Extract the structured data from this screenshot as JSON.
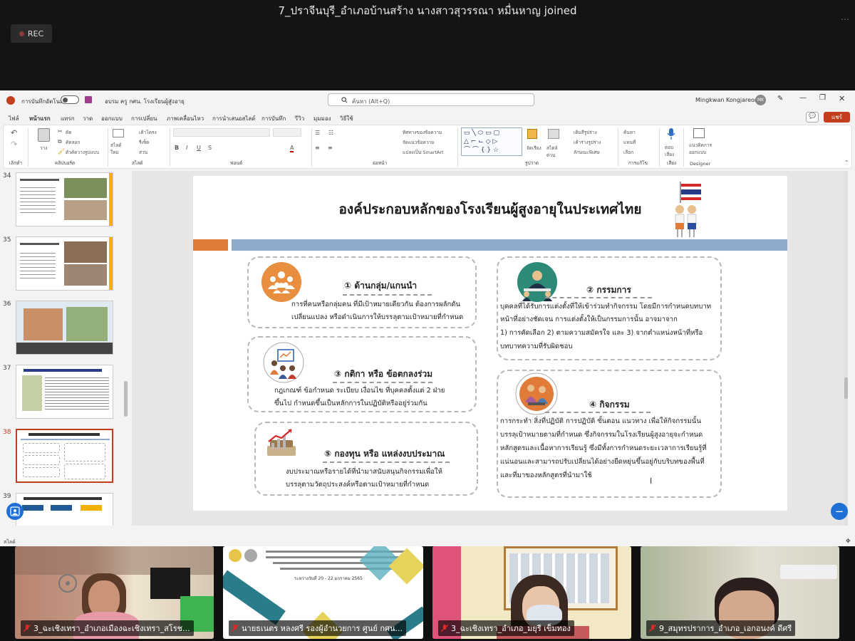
{
  "zoom": {
    "title": "7_ปราจีนบุรี_อำเภอบ้านสร้าง  นางสาวสุวรรณา  หมื่นหาญ joined",
    "rec_label": "REC"
  },
  "ppt": {
    "autosave_label": "การบันทึกอัตโนมัติ",
    "doc_title": "อบรม ครู กศน. โรงเรียนผู้สูงอายุ",
    "search_placeholder": "ค้นหา (Alt+Q)",
    "user_name": "Mingkwan Kongjareon",
    "user_initials": "MK",
    "share_label": "แชร์",
    "tabs": [
      "ไฟล์",
      "หน้าแรก",
      "แทรก",
      "วาด",
      "ออกแบบ",
      "การเปลี่ยน",
      "ภาพเคลื่อนไหว",
      "การนำเสนอสไลด์",
      "การบันทึก",
      "รีวิว",
      "มุมมอง",
      "วิธีใช้"
    ],
    "ribbon": {
      "undo_label": "เลิกทำ",
      "paste_label": "วาง",
      "cut_label": "ตัด",
      "copy_label": "คัดลอก",
      "format_painter_label": "ตัวคัดวางรูปแบบ",
      "clipboard_label": "คลิปบอร์ด",
      "new_slide_label": "สไลด์ใหม่",
      "layout_label": "เค้าโครง",
      "reset_label": "รีเซ็ต",
      "section_label": "ส่วน",
      "slides_label": "สไลด์",
      "font_label": "ฟอนต์",
      "paragraph_label": "ย่อหน้า",
      "text_direction_label": "ทิศทางของข้อความ",
      "align_text_label": "จัดแนวข้อความ",
      "smartart_label": "แปลงเป็น SmartArt",
      "arrange_label": "จัดเรียง",
      "quick_styles_label": "สไตล์ด่วน",
      "shape_fill_label": "เติมสีรูปร่าง",
      "shape_outline_label": "เค้าร่างรูปร่าง",
      "shape_effects_label": "ลักษณะพิเศษ",
      "drawing_label": "รูปวาด",
      "find_label": "ค้นหา",
      "replace_label": "แทนที่",
      "select_label": "เลือก",
      "editing_label": "การแก้ไข",
      "dictate_label": "ตอบ เสียง",
      "voice_label": "เสียง",
      "designer_btn_label": "แนวคิดการออกแบบ",
      "designer_label": "Designer"
    },
    "thumbs": [
      {
        "num": "34"
      },
      {
        "num": "35"
      },
      {
        "num": "36"
      },
      {
        "num": "37"
      },
      {
        "num": "38"
      },
      {
        "num": "39"
      }
    ],
    "status_left": "สไลด์"
  },
  "slide": {
    "title": "องค์ประกอบหลักของโรงเรียนผู้สูงอายุในประเทศไทย",
    "cards": [
      {
        "title": "① ด้านกลุ่ม/แกนนำ",
        "lines": [
          "การที่คนหรือกลุ่มคน ที่มีเป้าหมายเดียวกัน ต้องการผลักดัน",
          "เปลี่ยนแปลง หรือดำเนินการให้บรรลุตามเป้าหมายที่กำหนด"
        ]
      },
      {
        "title": "③ กติกา หรือ ข้อตกลงร่วม",
        "lines": [
          "กฎเกณฑ์ ข้อกำหนด ระเบียบ เงื่อนไข ที่บุคคลตั้งแต่  2 ฝ่าย",
          "ขึ้นไป กำหนดขึ้นเป็นหลักการในปฏิบัติหรืออยู่ร่วมกัน"
        ]
      },
      {
        "title": "⑤ กองทุน หรือ แหล่งงบประมาณ",
        "lines": [
          "งบประมาณหรือรายได้ที่นำมาสนับสนุนกิจกรรมเพื่อให้",
          "บรรลุตามวัตถุประสงค์หรือตามเป้าหมายที่กำหนด"
        ]
      },
      {
        "title": "② กรรมการ",
        "lines": [
          "บุคคลที่ได้รับการแต่งตั้งที่ให้เข้าร่วมทำกิจกรรม โดยมีการกำหนดบทบาท",
          "หน้าที่อย่างชัดเจน การแต่งตั้งให้เป็นกรรมการนั้น อาจมาจาก",
          "1) การคัดเลือก  2) ตามความสมัครใจ  และ  3) จากตำแหน่งหน้าที่หรือ",
          "บทบาทความที่รับผิดชอบ"
        ]
      },
      {
        "title": "④ กิจกรรม",
        "lines": [
          "การกระทำ สิ่งที่ปฏิบัติ การปฏิบัติ ขั้นตอน แนวทาง เพื่อให้กิจกรรมนั้น",
          "บรรลุเป้าหมายตามที่กำหนด ซึ่งกิจกรรมในโรงเรียนผู้สูงอายุจะกำหนด",
          "หลักสูตรและเนื้อหาการเรียนรู้ ซึ่งมีทั้งการกำหนดระยะเวลาการเรียนรู้ที่",
          "แน่นอนและสามารถปรับเปลี่ยนได้อย่างยืดหยุ่นขึ้นอยู่กับบริบทของพื้นที่",
          "และที่มาของหลักสูตรที่นำมาใช้"
        ]
      }
    ]
  },
  "participants": [
    {
      "name": "3_ฉะเชิงเทรา_อำเภอเมืองฉะเชิงเทรา_สโรช..."
    },
    {
      "name": "นายธเนตร หลงศรี รองผู้อำนวยการ ศูนย์ กศน..."
    },
    {
      "name": "3_ฉะเชิงเทรา_อำเภอ_มยุรี เข็มทอง"
    },
    {
      "name": "9_สมุทรปราการ_อำเภอ_เอกอนงค์ ดีศรี"
    }
  ],
  "shared_slide": {
    "date_line": "ระหว่างวันที่ 20 - 22 มกราคม 2565"
  },
  "colors": {
    "ppt_accent": "#c43e1c",
    "slide_orange": "#e07b39",
    "slide_blue_bar": "#8eaacb",
    "zoom_blue": "#1e6fd6",
    "muted_red": "#e02828"
  }
}
